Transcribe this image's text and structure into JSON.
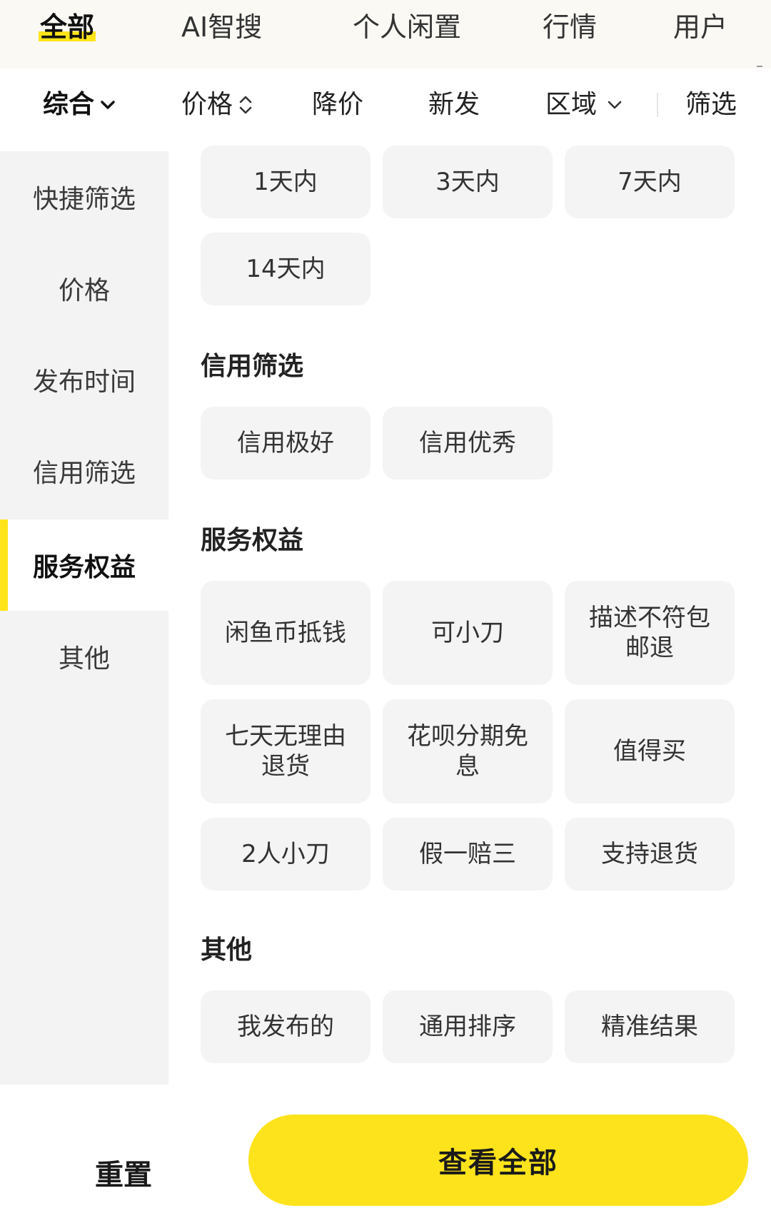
{
  "top_tabs": [
    {
      "label": "全部",
      "active": true
    },
    {
      "label": "AI智搜",
      "active": false
    },
    {
      "label": "个人闲置",
      "active": false
    },
    {
      "label": "行情",
      "active": false
    },
    {
      "label": "用户",
      "active": false
    }
  ],
  "sort_bar": {
    "comprehensive": "综合",
    "price": "价格",
    "price_drop": "降价",
    "new": "新发",
    "region": "区域",
    "filter": "筛选"
  },
  "sidebar": {
    "items": [
      {
        "label": "快捷筛选",
        "active": false
      },
      {
        "label": "价格",
        "active": false
      },
      {
        "label": "发布时间",
        "active": false
      },
      {
        "label": "信用筛选",
        "active": false
      },
      {
        "label": "服务权益",
        "active": true
      },
      {
        "label": "其他",
        "active": false
      }
    ]
  },
  "publish_time": {
    "options": [
      "1天内",
      "3天内",
      "7天内",
      "14天内"
    ]
  },
  "credit": {
    "title": "信用筛选",
    "options": [
      "信用极好",
      "信用优秀"
    ]
  },
  "service": {
    "title": "服务权益",
    "options": [
      "闲鱼币抵钱",
      "可小刀",
      "描述不符包邮退",
      "七天无理由退货",
      "花呗分期免息",
      "值得买",
      "2人小刀",
      "假一赔三",
      "支持退货"
    ]
  },
  "other": {
    "title": "其他",
    "options": [
      "我发布的",
      "通用排序",
      "精准结果"
    ]
  },
  "bottom": {
    "reset_label": "重置",
    "view_all_label": "查看全部"
  },
  "colors": {
    "accent_yellow": "#fde31b",
    "chip_bg": "#f4f4f4",
    "sidebar_bg": "#f3f3f3"
  }
}
